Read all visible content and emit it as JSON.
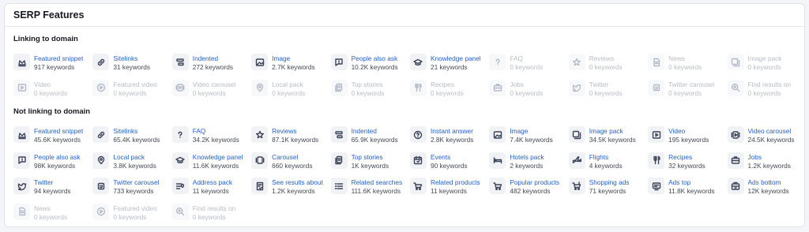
{
  "card": {
    "title": "SERP Features"
  },
  "sections": [
    {
      "title": "Linking to domain",
      "items": [
        {
          "label": "Featured snippet",
          "count": "917 keywords",
          "icon": "crown",
          "active": true
        },
        {
          "label": "Sitelinks",
          "count": "31 keywords",
          "icon": "link",
          "active": true
        },
        {
          "label": "Indented",
          "count": "272 keywords",
          "icon": "indent",
          "active": true
        },
        {
          "label": "Image",
          "count": "2.7K keywords",
          "icon": "image",
          "active": true
        },
        {
          "label": "People also ask",
          "count": "10.2K keywords",
          "icon": "chat-question",
          "active": true
        },
        {
          "label": "Knowledge panel",
          "count": "21 keywords",
          "icon": "graduation-cap",
          "active": true
        },
        {
          "label": "FAQ",
          "count": "0 keywords",
          "icon": "question",
          "active": false
        },
        {
          "label": "Reviews",
          "count": "0 keywords",
          "icon": "star",
          "active": false
        },
        {
          "label": "News",
          "count": "0 keywords",
          "icon": "news",
          "active": false
        },
        {
          "label": "Image pack",
          "count": "0 keywords",
          "icon": "image-pack",
          "active": false
        },
        {
          "label": "Video",
          "count": "0 keywords",
          "icon": "video",
          "active": false
        },
        {
          "label": "Featured video",
          "count": "0 keywords",
          "icon": "play-circle",
          "active": false
        },
        {
          "label": "Video carousel",
          "count": "0 keywords",
          "icon": "video-carousel",
          "active": false
        },
        {
          "label": "Local pack",
          "count": "0 keywords",
          "icon": "pin",
          "active": false
        },
        {
          "label": "Top stories",
          "count": "0 keywords",
          "icon": "stories",
          "active": false
        },
        {
          "label": "Recipes",
          "count": "0 keywords",
          "icon": "fork-knife",
          "active": false
        },
        {
          "label": "Jobs",
          "count": "0 keywords",
          "icon": "briefcase",
          "active": false
        },
        {
          "label": "Twitter",
          "count": "0 keywords",
          "icon": "twitter",
          "active": false
        },
        {
          "label": "Twitter carousel",
          "count": "0 keywords",
          "icon": "twitter-carousel",
          "active": false
        },
        {
          "label": "Find results on",
          "count": "0 keywords",
          "icon": "search-plus",
          "active": false
        }
      ]
    },
    {
      "title": "Not linking to domain",
      "items": [
        {
          "label": "Featured snippet",
          "count": "45.6K keywords",
          "icon": "crown",
          "active": true
        },
        {
          "label": "Sitelinks",
          "count": "65.4K keywords",
          "icon": "link",
          "active": true
        },
        {
          "label": "FAQ",
          "count": "34.2K keywords",
          "icon": "question",
          "active": true
        },
        {
          "label": "Reviews",
          "count": "87.1K keywords",
          "icon": "star",
          "active": true
        },
        {
          "label": "Indented",
          "count": "65.9K keywords",
          "icon": "indent",
          "active": true
        },
        {
          "label": "Instant answer",
          "count": "2.8K keywords",
          "icon": "question-circle",
          "active": true
        },
        {
          "label": "Image",
          "count": "7.4K keywords",
          "icon": "image",
          "active": true
        },
        {
          "label": "Image pack",
          "count": "34.5K keywords",
          "icon": "image-pack",
          "active": true
        },
        {
          "label": "Video",
          "count": "195 keywords",
          "icon": "video",
          "active": true
        },
        {
          "label": "Video carousel",
          "count": "24.5K keywords",
          "icon": "video-carousel",
          "active": true
        },
        {
          "label": "People also ask",
          "count": "98K keywords",
          "icon": "chat-question",
          "active": true
        },
        {
          "label": "Local pack",
          "count": "3.8K keywords",
          "icon": "pin",
          "active": true
        },
        {
          "label": "Knowledge panel",
          "count": "11.6K keywords",
          "icon": "graduation-cap",
          "active": true
        },
        {
          "label": "Carousel",
          "count": "660 keywords",
          "icon": "carousel",
          "active": true
        },
        {
          "label": "Top stories",
          "count": "1K keywords",
          "icon": "stories",
          "active": true
        },
        {
          "label": "Events",
          "count": "90 keywords",
          "icon": "calendar",
          "active": true
        },
        {
          "label": "Hotels pack",
          "count": "2 keywords",
          "icon": "bed",
          "active": true
        },
        {
          "label": "Flights",
          "count": "4 keywords",
          "icon": "plane",
          "active": true
        },
        {
          "label": "Recipes",
          "count": "32 keywords",
          "icon": "fork-knife",
          "active": true
        },
        {
          "label": "Jobs",
          "count": "1.2K keywords",
          "icon": "briefcase",
          "active": true
        },
        {
          "label": "Twitter",
          "count": "94 keywords",
          "icon": "twitter",
          "active": true
        },
        {
          "label": "Twitter carousel",
          "count": "733 keywords",
          "icon": "twitter-carousel",
          "active": true
        },
        {
          "label": "Address pack",
          "count": "11 keywords",
          "icon": "address",
          "active": true
        },
        {
          "label": "See results about",
          "count": "1.2K keywords",
          "icon": "doc-check",
          "active": true
        },
        {
          "label": "Related searches",
          "count": "111.6K keywords",
          "icon": "list",
          "active": true
        },
        {
          "label": "Related products",
          "count": "11 keywords",
          "icon": "cart",
          "active": true
        },
        {
          "label": "Popular products",
          "count": "482 keywords",
          "icon": "cart",
          "active": true
        },
        {
          "label": "Shopping ads",
          "count": "71 keywords",
          "icon": "cart-ad",
          "active": true
        },
        {
          "label": "Ads top",
          "count": "11.8K keywords",
          "icon": "ad-top",
          "active": true
        },
        {
          "label": "Ads bottom",
          "count": "12K keywords",
          "icon": "ad-bottom",
          "active": true
        },
        {
          "label": "News",
          "count": "0 keywords",
          "icon": "news",
          "active": false
        },
        {
          "label": "Featured video",
          "count": "0 keywords",
          "icon": "play-circle",
          "active": false
        },
        {
          "label": "Find results on",
          "count": "0 keywords",
          "icon": "search-plus",
          "active": false
        }
      ]
    }
  ]
}
